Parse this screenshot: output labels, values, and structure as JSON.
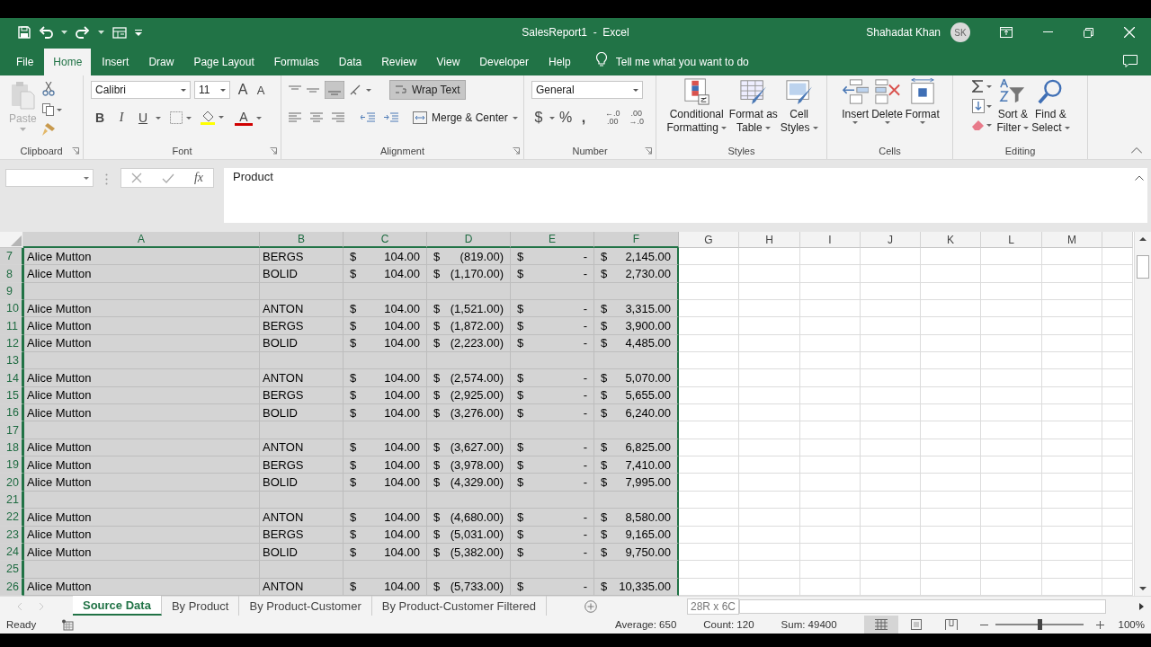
{
  "title_bar": {
    "document": "SalesReport1  -  Excel",
    "user": "Shahadat Khan",
    "initials": "SK"
  },
  "menu_tabs": [
    {
      "label": "File",
      "selected": false
    },
    {
      "label": "Home",
      "selected": true
    },
    {
      "label": "Insert",
      "selected": false
    },
    {
      "label": "Draw",
      "selected": false
    },
    {
      "label": "Page Layout",
      "selected": false
    },
    {
      "label": "Formulas",
      "selected": false
    },
    {
      "label": "Data",
      "selected": false
    },
    {
      "label": "Review",
      "selected": false
    },
    {
      "label": "View",
      "selected": false
    },
    {
      "label": "Developer",
      "selected": false
    },
    {
      "label": "Help",
      "selected": false
    }
  ],
  "tell_me": "Tell me what you want to do",
  "ribbon": {
    "clipboard": {
      "paste": "Paste",
      "label": "Clipboard"
    },
    "font": {
      "name": "Calibri",
      "size": "11",
      "grow": "A",
      "shrink": "A",
      "bold": "B",
      "italic": "I",
      "underline": "U",
      "color_letter": "A",
      "label": "Font"
    },
    "alignment": {
      "wrap": {
        "label": "Wrap Text",
        "on": true
      },
      "merge": "Merge & Center",
      "label": "Alignment"
    },
    "number": {
      "format": "General",
      "currency": "$",
      "percent": "%",
      "comma": ",",
      "decimals": [
        {
          "top": "←.0",
          "bottom": ".00"
        },
        {
          "top": ".00",
          "bottom": "→.0"
        }
      ],
      "label": "Number"
    },
    "styles": {
      "buttons": [
        {
          "line1": "Conditional",
          "line2": "Formatting"
        },
        {
          "line1": "Format as",
          "line2": "Table"
        },
        {
          "line1": "Cell",
          "line2": "Styles"
        }
      ],
      "label": "Styles"
    },
    "cells": {
      "buttons": [
        "Insert",
        "Delete",
        "Format"
      ],
      "label": "Cells"
    },
    "editing": {
      "buttons": [
        {
          "line1": "Sort &",
          "line2": "Filter"
        },
        {
          "line1": "Find &",
          "line2": "Select"
        }
      ],
      "label": "Editing"
    }
  },
  "formula_bar": {
    "function_label": "fx",
    "value": "Product"
  },
  "columns": [
    {
      "label": "A",
      "selected": true
    },
    {
      "label": "B",
      "selected": true
    },
    {
      "label": "C",
      "selected": true
    },
    {
      "label": "D",
      "selected": true
    },
    {
      "label": "E",
      "selected": true
    },
    {
      "label": "F",
      "selected": true
    },
    {
      "label": "G",
      "selected": false
    },
    {
      "label": "H",
      "selected": false
    },
    {
      "label": "I",
      "selected": false
    },
    {
      "label": "J",
      "selected": false
    },
    {
      "label": "K",
      "selected": false
    },
    {
      "label": "L",
      "selected": false
    },
    {
      "label": "M",
      "selected": false
    }
  ],
  "rows": [
    {
      "number": "7",
      "selected": true,
      "cells": [
        {
          "kind": "text",
          "text": "Alice Mutton"
        },
        {
          "kind": "text",
          "text": "BERGS"
        },
        {
          "kind": "currency",
          "symbol": "$",
          "amount": "104.00"
        },
        {
          "kind": "currency",
          "symbol": "$",
          "amount": "(819.00)"
        },
        {
          "kind": "currency",
          "symbol": "$",
          "amount": "-"
        },
        {
          "kind": "currency",
          "symbol": "$",
          "amount": "2,145.00"
        }
      ]
    },
    {
      "number": "8",
      "selected": true,
      "cells": [
        {
          "kind": "text",
          "text": "Alice Mutton"
        },
        {
          "kind": "text",
          "text": "BOLID"
        },
        {
          "kind": "currency",
          "symbol": "$",
          "amount": "104.00"
        },
        {
          "kind": "currency",
          "symbol": "$",
          "amount": "(1,170.00)"
        },
        {
          "kind": "currency",
          "symbol": "$",
          "amount": "-"
        },
        {
          "kind": "currency",
          "symbol": "$",
          "amount": "2,730.00"
        }
      ]
    },
    {
      "number": "9",
      "selected": true,
      "cells": []
    },
    {
      "number": "10",
      "selected": true,
      "cells": [
        {
          "kind": "text",
          "text": "Alice Mutton"
        },
        {
          "kind": "text",
          "text": "ANTON"
        },
        {
          "kind": "currency",
          "symbol": "$",
          "amount": "104.00"
        },
        {
          "kind": "currency",
          "symbol": "$",
          "amount": "(1,521.00)"
        },
        {
          "kind": "currency",
          "symbol": "$",
          "amount": "-"
        },
        {
          "kind": "currency",
          "symbol": "$",
          "amount": "3,315.00"
        }
      ]
    },
    {
      "number": "11",
      "selected": true,
      "cells": [
        {
          "kind": "text",
          "text": "Alice Mutton"
        },
        {
          "kind": "text",
          "text": "BERGS"
        },
        {
          "kind": "currency",
          "symbol": "$",
          "amount": "104.00"
        },
        {
          "kind": "currency",
          "symbol": "$",
          "amount": "(1,872.00)"
        },
        {
          "kind": "currency",
          "symbol": "$",
          "amount": "-"
        },
        {
          "kind": "currency",
          "symbol": "$",
          "amount": "3,900.00"
        }
      ]
    },
    {
      "number": "12",
      "selected": true,
      "cells": [
        {
          "kind": "text",
          "text": "Alice Mutton"
        },
        {
          "kind": "text",
          "text": "BOLID"
        },
        {
          "kind": "currency",
          "symbol": "$",
          "amount": "104.00"
        },
        {
          "kind": "currency",
          "symbol": "$",
          "amount": "(2,223.00)"
        },
        {
          "kind": "currency",
          "symbol": "$",
          "amount": "-"
        },
        {
          "kind": "currency",
          "symbol": "$",
          "amount": "4,485.00"
        }
      ]
    },
    {
      "number": "13",
      "selected": true,
      "cells": []
    },
    {
      "number": "14",
      "selected": true,
      "cells": [
        {
          "kind": "text",
          "text": "Alice Mutton"
        },
        {
          "kind": "text",
          "text": "ANTON"
        },
        {
          "kind": "currency",
          "symbol": "$",
          "amount": "104.00"
        },
        {
          "kind": "currency",
          "symbol": "$",
          "amount": "(2,574.00)"
        },
        {
          "kind": "currency",
          "symbol": "$",
          "amount": "-"
        },
        {
          "kind": "currency",
          "symbol": "$",
          "amount": "5,070.00"
        }
      ]
    },
    {
      "number": "15",
      "selected": true,
      "cells": [
        {
          "kind": "text",
          "text": "Alice Mutton"
        },
        {
          "kind": "text",
          "text": "BERGS"
        },
        {
          "kind": "currency",
          "symbol": "$",
          "amount": "104.00"
        },
        {
          "kind": "currency",
          "symbol": "$",
          "amount": "(2,925.00)"
        },
        {
          "kind": "currency",
          "symbol": "$",
          "amount": "-"
        },
        {
          "kind": "currency",
          "symbol": "$",
          "amount": "5,655.00"
        }
      ]
    },
    {
      "number": "16",
      "selected": true,
      "cells": [
        {
          "kind": "text",
          "text": "Alice Mutton"
        },
        {
          "kind": "text",
          "text": "BOLID"
        },
        {
          "kind": "currency",
          "symbol": "$",
          "amount": "104.00"
        },
        {
          "kind": "currency",
          "symbol": "$",
          "amount": "(3,276.00)"
        },
        {
          "kind": "currency",
          "symbol": "$",
          "amount": "-"
        },
        {
          "kind": "currency",
          "symbol": "$",
          "amount": "6,240.00"
        }
      ]
    },
    {
      "number": "17",
      "selected": true,
      "cells": []
    },
    {
      "number": "18",
      "selected": true,
      "cells": [
        {
          "kind": "text",
          "text": "Alice Mutton"
        },
        {
          "kind": "text",
          "text": "ANTON"
        },
        {
          "kind": "currency",
          "symbol": "$",
          "amount": "104.00"
        },
        {
          "kind": "currency",
          "symbol": "$",
          "amount": "(3,627.00)"
        },
        {
          "kind": "currency",
          "symbol": "$",
          "amount": "-"
        },
        {
          "kind": "currency",
          "symbol": "$",
          "amount": "6,825.00"
        }
      ]
    },
    {
      "number": "19",
      "selected": true,
      "cells": [
        {
          "kind": "text",
          "text": "Alice Mutton"
        },
        {
          "kind": "text",
          "text": "BERGS"
        },
        {
          "kind": "currency",
          "symbol": "$",
          "amount": "104.00"
        },
        {
          "kind": "currency",
          "symbol": "$",
          "amount": "(3,978.00)"
        },
        {
          "kind": "currency",
          "symbol": "$",
          "amount": "-"
        },
        {
          "kind": "currency",
          "symbol": "$",
          "amount": "7,410.00"
        }
      ]
    },
    {
      "number": "20",
      "selected": true,
      "cells": [
        {
          "kind": "text",
          "text": "Alice Mutton"
        },
        {
          "kind": "text",
          "text": "BOLID"
        },
        {
          "kind": "currency",
          "symbol": "$",
          "amount": "104.00"
        },
        {
          "kind": "currency",
          "symbol": "$",
          "amount": "(4,329.00)"
        },
        {
          "kind": "currency",
          "symbol": "$",
          "amount": "-"
        },
        {
          "kind": "currency",
          "symbol": "$",
          "amount": "7,995.00"
        }
      ]
    },
    {
      "number": "21",
      "selected": true,
      "cells": []
    },
    {
      "number": "22",
      "selected": true,
      "cells": [
        {
          "kind": "text",
          "text": "Alice Mutton"
        },
        {
          "kind": "text",
          "text": "ANTON"
        },
        {
          "kind": "currency",
          "symbol": "$",
          "amount": "104.00"
        },
        {
          "kind": "currency",
          "symbol": "$",
          "amount": "(4,680.00)"
        },
        {
          "kind": "currency",
          "symbol": "$",
          "amount": "-"
        },
        {
          "kind": "currency",
          "symbol": "$",
          "amount": "8,580.00"
        }
      ]
    },
    {
      "number": "23",
      "selected": true,
      "cells": [
        {
          "kind": "text",
          "text": "Alice Mutton"
        },
        {
          "kind": "text",
          "text": "BERGS"
        },
        {
          "kind": "currency",
          "symbol": "$",
          "amount": "104.00"
        },
        {
          "kind": "currency",
          "symbol": "$",
          "amount": "(5,031.00)"
        },
        {
          "kind": "currency",
          "symbol": "$",
          "amount": "-"
        },
        {
          "kind": "currency",
          "symbol": "$",
          "amount": "9,165.00"
        }
      ]
    },
    {
      "number": "24",
      "selected": true,
      "cells": [
        {
          "kind": "text",
          "text": "Alice Mutton"
        },
        {
          "kind": "text",
          "text": "BOLID"
        },
        {
          "kind": "currency",
          "symbol": "$",
          "amount": "104.00"
        },
        {
          "kind": "currency",
          "symbol": "$",
          "amount": "(5,382.00)"
        },
        {
          "kind": "currency",
          "symbol": "$",
          "amount": "-"
        },
        {
          "kind": "currency",
          "symbol": "$",
          "amount": "9,750.00"
        }
      ]
    },
    {
      "number": "25",
      "selected": true,
      "cells": []
    },
    {
      "number": "26",
      "selected": true,
      "cells": [
        {
          "kind": "text",
          "text": "Alice Mutton"
        },
        {
          "kind": "text",
          "text": "ANTON"
        },
        {
          "kind": "currency",
          "symbol": "$",
          "amount": "104.00"
        },
        {
          "kind": "currency",
          "symbol": "$",
          "amount": "(5,733.00)"
        },
        {
          "kind": "currency",
          "symbol": "$",
          "amount": "-"
        },
        {
          "kind": "currency",
          "symbol": "$",
          "amount": "10,335.00"
        }
      ]
    }
  ],
  "sheet_tabs": [
    {
      "label": "Source Data",
      "selected": true
    },
    {
      "label": "By Product",
      "selected": false
    },
    {
      "label": "By Product-Customer",
      "selected": false
    },
    {
      "label": "By Product-Customer Filtered",
      "selected": false
    }
  ],
  "selection_size": "28R x 6C",
  "status_bar": {
    "mode": "Ready",
    "average": "Average: 650",
    "count": "Count: 120",
    "sum": "Sum: 49400",
    "zoom": {
      "level": 0.5,
      "reading": "100%"
    }
  }
}
